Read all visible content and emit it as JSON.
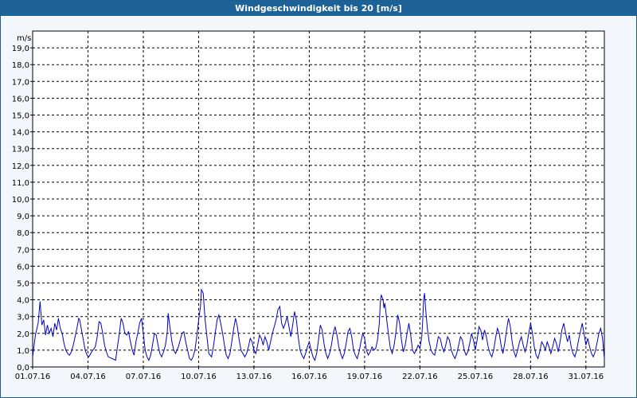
{
  "window": {
    "title": "Windgeschwindigkeit bis 20 [m/s]"
  },
  "colors": {
    "titlebar": "#1d6296",
    "series": "#0000c8",
    "grid": "#000000",
    "background": "#f3f6fb"
  },
  "chart_data": {
    "type": "line",
    "title": "Windgeschwindigkeit bis 20 [m/s]",
    "ylabel": "m/s",
    "xlabel": "",
    "ylim": [
      0,
      20
    ],
    "xlim_days": [
      1,
      32
    ],
    "grid": true,
    "yticks": [
      "0,0",
      "1,0",
      "2,0",
      "3,0",
      "4,0",
      "5,0",
      "6,0",
      "7,0",
      "8,0",
      "9,0",
      "10,0",
      "11,0",
      "12,0",
      "13,0",
      "14,0",
      "15,0",
      "16,0",
      "17,0",
      "18,0",
      "19,0"
    ],
    "xticks": [
      "01.07.16",
      "04.07.16",
      "07.07.16",
      "10.07.16",
      "13.07.16",
      "16.07.16",
      "19.07.16",
      "22.07.16",
      "25.07.16",
      "28.07.16",
      "31.07.16"
    ],
    "series": [
      {
        "points": [
          [
            1.0,
            0.6
          ],
          [
            1.15,
            1.9
          ],
          [
            1.3,
            2.6
          ],
          [
            1.4,
            3.9
          ],
          [
            1.5,
            2.5
          ],
          [
            1.6,
            2.8
          ],
          [
            1.7,
            1.9
          ],
          [
            1.8,
            2.5
          ],
          [
            1.9,
            2.0
          ],
          [
            2.0,
            2.3
          ],
          [
            2.1,
            1.8
          ],
          [
            2.2,
            2.6
          ],
          [
            2.3,
            2.2
          ],
          [
            2.4,
            2.9
          ],
          [
            2.5,
            2.3
          ],
          [
            2.6,
            2.0
          ],
          [
            2.7,
            1.4
          ],
          [
            2.8,
            1.0
          ],
          [
            2.9,
            0.8
          ],
          [
            3.0,
            0.7
          ],
          [
            3.1,
            0.9
          ],
          [
            3.2,
            1.3
          ],
          [
            3.3,
            1.8
          ],
          [
            3.4,
            2.3
          ],
          [
            3.5,
            2.9
          ],
          [
            3.55,
            2.8
          ],
          [
            3.65,
            2.2
          ],
          [
            3.75,
            1.6
          ],
          [
            3.85,
            1.0
          ],
          [
            3.95,
            0.7
          ],
          [
            4.05,
            0.6
          ],
          [
            4.2,
            0.9
          ],
          [
            4.4,
            1.2
          ],
          [
            4.5,
            1.8
          ],
          [
            4.6,
            2.7
          ],
          [
            4.7,
            2.6
          ],
          [
            4.8,
            2.0
          ],
          [
            4.9,
            1.3
          ],
          [
            5.0,
            0.9
          ],
          [
            5.1,
            0.6
          ],
          [
            5.3,
            0.5
          ],
          [
            5.5,
            0.4
          ],
          [
            5.6,
            1.2
          ],
          [
            5.7,
            2.0
          ],
          [
            5.8,
            2.9
          ],
          [
            5.9,
            2.6
          ],
          [
            6.0,
            2.0
          ],
          [
            6.1,
            1.9
          ],
          [
            6.2,
            2.1
          ],
          [
            6.3,
            1.5
          ],
          [
            6.4,
            1.0
          ],
          [
            6.5,
            0.7
          ],
          [
            6.6,
            1.5
          ],
          [
            6.7,
            2.0
          ],
          [
            6.8,
            2.6
          ],
          [
            6.9,
            2.9
          ],
          [
            7.0,
            2.0
          ],
          [
            7.1,
            1.0
          ],
          [
            7.2,
            0.6
          ],
          [
            7.3,
            0.4
          ],
          [
            7.4,
            0.7
          ],
          [
            7.5,
            1.3
          ],
          [
            7.6,
            2.0
          ],
          [
            7.7,
            1.9
          ],
          [
            7.8,
            1.3
          ],
          [
            7.9,
            0.8
          ],
          [
            8.0,
            0.6
          ],
          [
            8.1,
            0.9
          ],
          [
            8.2,
            1.3
          ],
          [
            8.3,
            2.1
          ],
          [
            8.35,
            3.2
          ],
          [
            8.45,
            2.3
          ],
          [
            8.55,
            1.5
          ],
          [
            8.65,
            1.0
          ],
          [
            8.75,
            0.8
          ],
          [
            8.9,
            1.2
          ],
          [
            9.0,
            1.6
          ],
          [
            9.1,
            2.0
          ],
          [
            9.2,
            2.1
          ],
          [
            9.3,
            1.5
          ],
          [
            9.4,
            1.0
          ],
          [
            9.5,
            0.5
          ],
          [
            9.6,
            0.4
          ],
          [
            9.7,
            0.6
          ],
          [
            9.8,
            1.0
          ],
          [
            9.9,
            1.8
          ],
          [
            10.0,
            2.8
          ],
          [
            10.1,
            3.6
          ],
          [
            10.15,
            4.6
          ],
          [
            10.25,
            4.4
          ],
          [
            10.35,
            2.8
          ],
          [
            10.45,
            1.8
          ],
          [
            10.55,
            0.8
          ],
          [
            10.7,
            0.6
          ],
          [
            10.8,
            1.2
          ],
          [
            10.9,
            2.0
          ],
          [
            11.0,
            2.8
          ],
          [
            11.1,
            3.1
          ],
          [
            11.2,
            2.6
          ],
          [
            11.3,
            2.0
          ],
          [
            11.4,
            1.3
          ],
          [
            11.5,
            0.7
          ],
          [
            11.6,
            0.5
          ],
          [
            11.7,
            0.8
          ],
          [
            11.8,
            1.5
          ],
          [
            11.9,
            2.3
          ],
          [
            12.0,
            2.9
          ],
          [
            12.1,
            2.4
          ],
          [
            12.2,
            1.6
          ],
          [
            12.3,
            1.0
          ],
          [
            12.4,
            0.8
          ],
          [
            12.5,
            0.6
          ],
          [
            12.6,
            0.8
          ],
          [
            12.7,
            1.2
          ],
          [
            12.8,
            1.7
          ],
          [
            12.9,
            1.5
          ],
          [
            13.0,
            1.0
          ],
          [
            13.1,
            0.8
          ],
          [
            13.2,
            1.3
          ],
          [
            13.3,
            1.9
          ],
          [
            13.4,
            1.7
          ],
          [
            13.5,
            1.3
          ],
          [
            13.6,
            1.8
          ],
          [
            13.7,
            1.5
          ],
          [
            13.8,
            1.0
          ],
          [
            13.9,
            1.5
          ],
          [
            14.0,
            2.0
          ],
          [
            14.1,
            2.4
          ],
          [
            14.2,
            2.8
          ],
          [
            14.3,
            3.4
          ],
          [
            14.4,
            3.6
          ],
          [
            14.5,
            2.6
          ],
          [
            14.6,
            2.3
          ],
          [
            14.7,
            2.6
          ],
          [
            14.8,
            3.0
          ],
          [
            14.9,
            2.4
          ],
          [
            15.0,
            1.8
          ],
          [
            15.1,
            2.5
          ],
          [
            15.2,
            3.3
          ],
          [
            15.3,
            2.8
          ],
          [
            15.4,
            1.8
          ],
          [
            15.5,
            1.0
          ],
          [
            15.6,
            0.7
          ],
          [
            15.7,
            0.5
          ],
          [
            15.8,
            0.8
          ],
          [
            15.9,
            1.2
          ],
          [
            16.0,
            1.5
          ],
          [
            16.1,
            1.0
          ],
          [
            16.2,
            0.6
          ],
          [
            16.3,
            0.4
          ],
          [
            16.4,
            0.8
          ],
          [
            16.5,
            1.6
          ],
          [
            16.6,
            2.5
          ],
          [
            16.7,
            2.2
          ],
          [
            16.8,
            1.4
          ],
          [
            16.9,
            0.8
          ],
          [
            17.0,
            0.5
          ],
          [
            17.1,
            0.8
          ],
          [
            17.2,
            1.3
          ],
          [
            17.3,
            2.0
          ],
          [
            17.4,
            2.4
          ],
          [
            17.5,
            1.9
          ],
          [
            17.6,
            1.2
          ],
          [
            17.7,
            0.8
          ],
          [
            17.8,
            0.5
          ],
          [
            17.9,
            0.8
          ],
          [
            18.0,
            1.4
          ],
          [
            18.1,
            2.1
          ],
          [
            18.2,
            2.3
          ],
          [
            18.3,
            1.8
          ],
          [
            18.4,
            1.0
          ],
          [
            18.5,
            0.7
          ],
          [
            18.6,
            0.5
          ],
          [
            18.7,
            0.9
          ],
          [
            18.8,
            1.5
          ],
          [
            18.9,
            2.0
          ],
          [
            19.0,
            1.7
          ],
          [
            19.1,
            1.0
          ],
          [
            19.2,
            0.7
          ],
          [
            19.3,
            0.9
          ],
          [
            19.4,
            1.2
          ],
          [
            19.5,
            1.0
          ],
          [
            19.6,
            1.1
          ],
          [
            19.7,
            1.6
          ],
          [
            19.8,
            2.6
          ],
          [
            19.85,
            3.8
          ],
          [
            19.9,
            4.3
          ],
          [
            20.0,
            4.0
          ],
          [
            20.05,
            3.5
          ],
          [
            20.1,
            3.8
          ],
          [
            20.2,
            2.8
          ],
          [
            20.3,
            1.9
          ],
          [
            20.4,
            1.1
          ],
          [
            20.5,
            0.8
          ],
          [
            20.6,
            1.3
          ],
          [
            20.7,
            2.1
          ],
          [
            20.8,
            3.1
          ],
          [
            20.9,
            2.6
          ],
          [
            21.0,
            1.6
          ],
          [
            21.1,
            0.9
          ],
          [
            21.2,
            1.3
          ],
          [
            21.3,
            2.0
          ],
          [
            21.4,
            2.6
          ],
          [
            21.5,
            1.9
          ],
          [
            21.6,
            1.0
          ],
          [
            21.7,
            0.8
          ],
          [
            21.8,
            1.0
          ],
          [
            21.9,
            1.3
          ],
          [
            22.0,
            1.1
          ],
          [
            22.1,
            1.8
          ],
          [
            22.15,
            2.8
          ],
          [
            22.2,
            4.0
          ],
          [
            22.25,
            4.4
          ],
          [
            22.3,
            3.6
          ],
          [
            22.4,
            2.3
          ],
          [
            22.5,
            1.5
          ],
          [
            22.6,
            1.0
          ],
          [
            22.7,
            0.8
          ],
          [
            22.8,
            0.7
          ],
          [
            22.9,
            1.2
          ],
          [
            23.0,
            1.8
          ],
          [
            23.1,
            1.7
          ],
          [
            23.2,
            1.2
          ],
          [
            23.3,
            0.9
          ],
          [
            23.4,
            1.3
          ],
          [
            23.5,
            1.8
          ],
          [
            23.6,
            1.6
          ],
          [
            23.7,
            1.0
          ],
          [
            23.8,
            0.7
          ],
          [
            23.9,
            0.5
          ],
          [
            24.0,
            0.8
          ],
          [
            24.1,
            1.3
          ],
          [
            24.2,
            1.8
          ],
          [
            24.3,
            1.6
          ],
          [
            24.4,
            1.0
          ],
          [
            24.5,
            0.7
          ],
          [
            24.6,
            0.9
          ],
          [
            24.7,
            1.4
          ],
          [
            24.8,
            2.0
          ],
          [
            24.9,
            1.6
          ],
          [
            25.0,
            1.0
          ],
          [
            25.1,
            1.6
          ],
          [
            25.2,
            2.4
          ],
          [
            25.3,
            2.2
          ],
          [
            25.4,
            1.6
          ],
          [
            25.5,
            2.2
          ],
          [
            25.6,
            1.8
          ],
          [
            25.7,
            1.2
          ],
          [
            25.8,
            0.8
          ],
          [
            25.9,
            0.6
          ],
          [
            26.0,
            1.0
          ],
          [
            26.1,
            1.7
          ],
          [
            26.2,
            2.3
          ],
          [
            26.3,
            2.0
          ],
          [
            26.4,
            1.3
          ],
          [
            26.5,
            0.8
          ],
          [
            26.6,
            1.4
          ],
          [
            26.7,
            2.2
          ],
          [
            26.8,
            2.9
          ],
          [
            26.9,
            2.4
          ],
          [
            27.0,
            1.5
          ],
          [
            27.1,
            0.9
          ],
          [
            27.2,
            0.6
          ],
          [
            27.3,
            1.0
          ],
          [
            27.4,
            1.5
          ],
          [
            27.5,
            1.8
          ],
          [
            27.6,
            1.3
          ],
          [
            27.7,
            0.9
          ],
          [
            27.8,
            1.3
          ],
          [
            27.9,
            2.0
          ],
          [
            28.0,
            2.6
          ],
          [
            28.1,
            2.0
          ],
          [
            28.2,
            1.2
          ],
          [
            28.3,
            0.7
          ],
          [
            28.4,
            0.5
          ],
          [
            28.5,
            0.9
          ],
          [
            28.6,
            1.5
          ],
          [
            28.7,
            1.3
          ],
          [
            28.8,
            1.0
          ],
          [
            28.9,
            1.5
          ],
          [
            29.0,
            1.2
          ],
          [
            29.1,
            0.8
          ],
          [
            29.2,
            1.2
          ],
          [
            29.3,
            1.7
          ],
          [
            29.4,
            1.4
          ],
          [
            29.5,
            0.9
          ],
          [
            29.6,
            1.5
          ],
          [
            29.7,
            2.2
          ],
          [
            29.8,
            2.6
          ],
          [
            29.9,
            2.0
          ],
          [
            30.0,
            1.5
          ],
          [
            30.1,
            1.9
          ],
          [
            30.2,
            1.2
          ],
          [
            30.3,
            0.8
          ],
          [
            30.4,
            0.6
          ],
          [
            30.5,
            1.0
          ],
          [
            30.6,
            1.6
          ],
          [
            30.7,
            2.1
          ],
          [
            30.8,
            2.6
          ],
          [
            30.9,
            2.0
          ],
          [
            31.0,
            1.3
          ],
          [
            31.1,
            1.7
          ],
          [
            31.2,
            1.2
          ],
          [
            31.3,
            0.8
          ],
          [
            31.4,
            0.6
          ],
          [
            31.5,
            0.9
          ],
          [
            31.6,
            1.4
          ],
          [
            31.7,
            2.0
          ],
          [
            31.8,
            2.3
          ],
          [
            31.9,
            1.7
          ],
          [
            32.0,
            0.5
          ]
        ]
      }
    ]
  }
}
